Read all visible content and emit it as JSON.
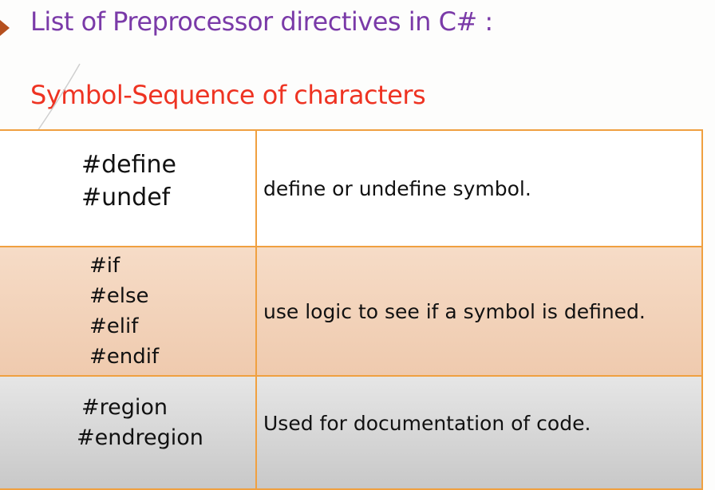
{
  "header": {
    "title": "List of Preprocessor directives in C# :",
    "subtitle": "Symbol-Sequence of  characters"
  },
  "colors": {
    "title": "#7a3aa8",
    "subtitle": "#ee3322",
    "border": "#f0a040",
    "bullet": "#b5501f"
  },
  "rows": [
    {
      "directives": [
        "#define",
        "#undef"
      ],
      "description": "define or undefine symbol."
    },
    {
      "directives": [
        "#if",
        "#else",
        "#elif",
        "#endif"
      ],
      "description": "use logic to see if a symbol is defined."
    },
    {
      "directives": [
        "#region",
        "#endregion"
      ],
      "description": "Used for documentation of code."
    }
  ]
}
